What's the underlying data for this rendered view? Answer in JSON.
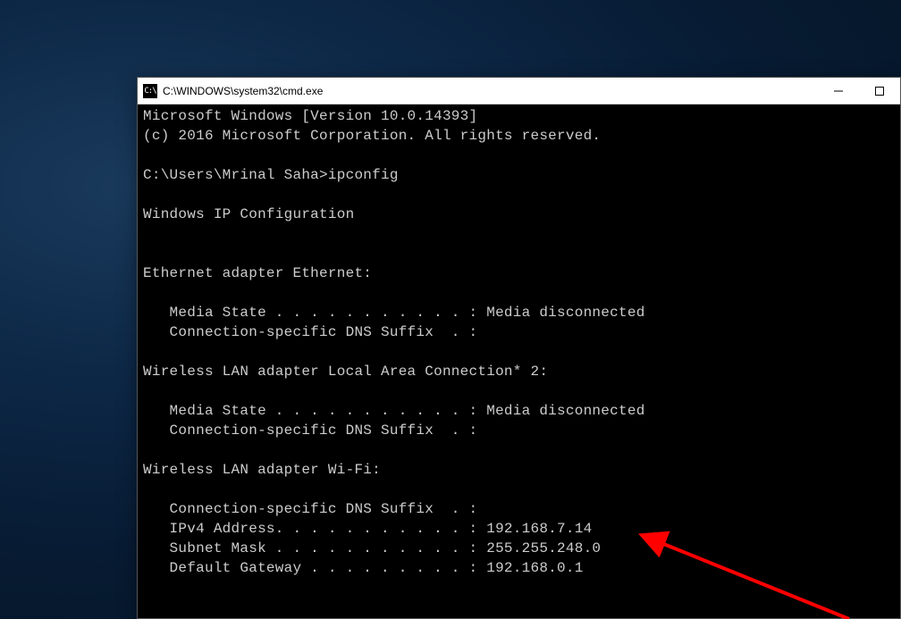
{
  "window": {
    "title": "C:\\WINDOWS\\system32\\cmd.exe",
    "icon_label": "C:\\"
  },
  "terminal": {
    "header_line1": "Microsoft Windows [Version 10.0.14393]",
    "header_line2": "(c) 2016 Microsoft Corporation. All rights reserved.",
    "prompt_line": "C:\\Users\\Mrinal Saha>ipconfig",
    "ipconfig_title": "Windows IP Configuration",
    "adapters": [
      {
        "name": "Ethernet adapter Ethernet:",
        "lines": [
          "   Media State . . . . . . . . . . . : Media disconnected",
          "   Connection-specific DNS Suffix  . :"
        ]
      },
      {
        "name": "Wireless LAN adapter Local Area Connection* 2:",
        "lines": [
          "   Media State . . . . . . . . . . . : Media disconnected",
          "   Connection-specific DNS Suffix  . :"
        ]
      },
      {
        "name": "Wireless LAN adapter Wi-Fi:",
        "lines": [
          "   Connection-specific DNS Suffix  . :",
          "   IPv4 Address. . . . . . . . . . . : 192.168.7.14",
          "   Subnet Mask . . . . . . . . . . . : 255.255.248.0",
          "   Default Gateway . . . . . . . . . : 192.168.0.1"
        ]
      }
    ]
  },
  "annotation": {
    "arrow_color": "#ff0000"
  }
}
